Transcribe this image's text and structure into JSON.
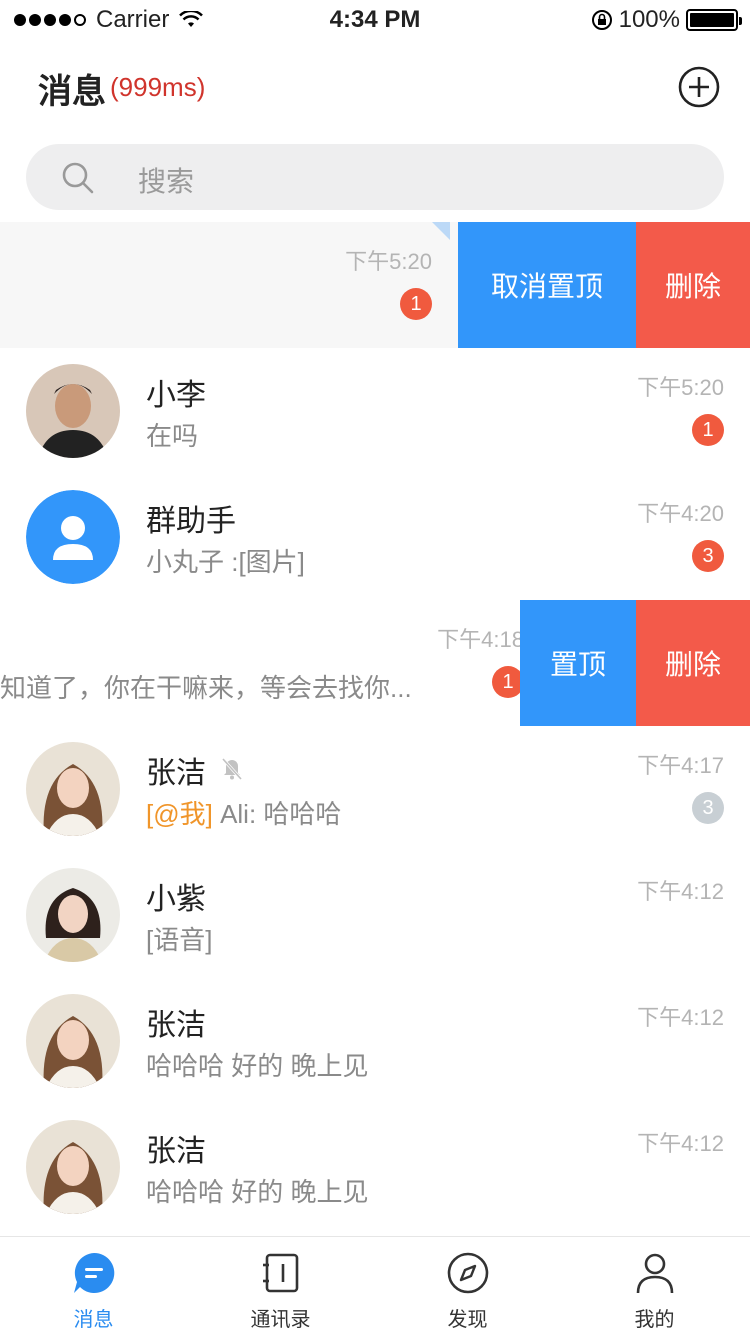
{
  "status_bar": {
    "carrier": "Carrier",
    "time": "4:34 PM",
    "battery": "100%"
  },
  "header": {
    "title": "消息",
    "latency": "(999ms)"
  },
  "search": {
    "placeholder": "搜索"
  },
  "conversations": [
    {
      "name": "",
      "preview": "",
      "time": "下午5:20",
      "badge": "1",
      "pinned": true,
      "actions": [
        "取消置顶",
        "删除"
      ]
    },
    {
      "name": "小李",
      "preview": "在吗",
      "time": "下午5:20",
      "badge": "1"
    },
    {
      "name": "群助手",
      "preview": "小丸子 :[图片]",
      "time": "下午4:20",
      "badge": "3"
    },
    {
      "name": "",
      "preview": "知道了，你在干嘛来，等会去找你...",
      "time": "下午4:18",
      "badge": "1",
      "actions": [
        "置顶",
        "删除"
      ]
    },
    {
      "name": "张洁",
      "mention": "[@我]",
      "preview": " Ali: 哈哈哈",
      "time": "下午4:17",
      "badge": "3",
      "muted": true
    },
    {
      "name": "小紫",
      "preview": "[语音]",
      "time": "下午4:12",
      "badge": ""
    },
    {
      "name": "张洁",
      "preview": "哈哈哈 好的 晚上见",
      "time": "下午4:12",
      "badge": ""
    },
    {
      "name": "张洁",
      "preview": "哈哈哈 好的 晚上见",
      "time": "下午4:12",
      "badge": ""
    }
  ],
  "tabs": [
    {
      "label": "消息",
      "icon": "chat-bubble-icon",
      "active": true
    },
    {
      "label": "通讯录",
      "icon": "contacts-book-icon"
    },
    {
      "label": "发现",
      "icon": "compass-icon"
    },
    {
      "label": "我的",
      "icon": "person-icon"
    }
  ],
  "colors": {
    "accent": "#3296fa",
    "danger": "#f35a4a",
    "badge": "#f05a3e",
    "mention": "#f0952a"
  }
}
